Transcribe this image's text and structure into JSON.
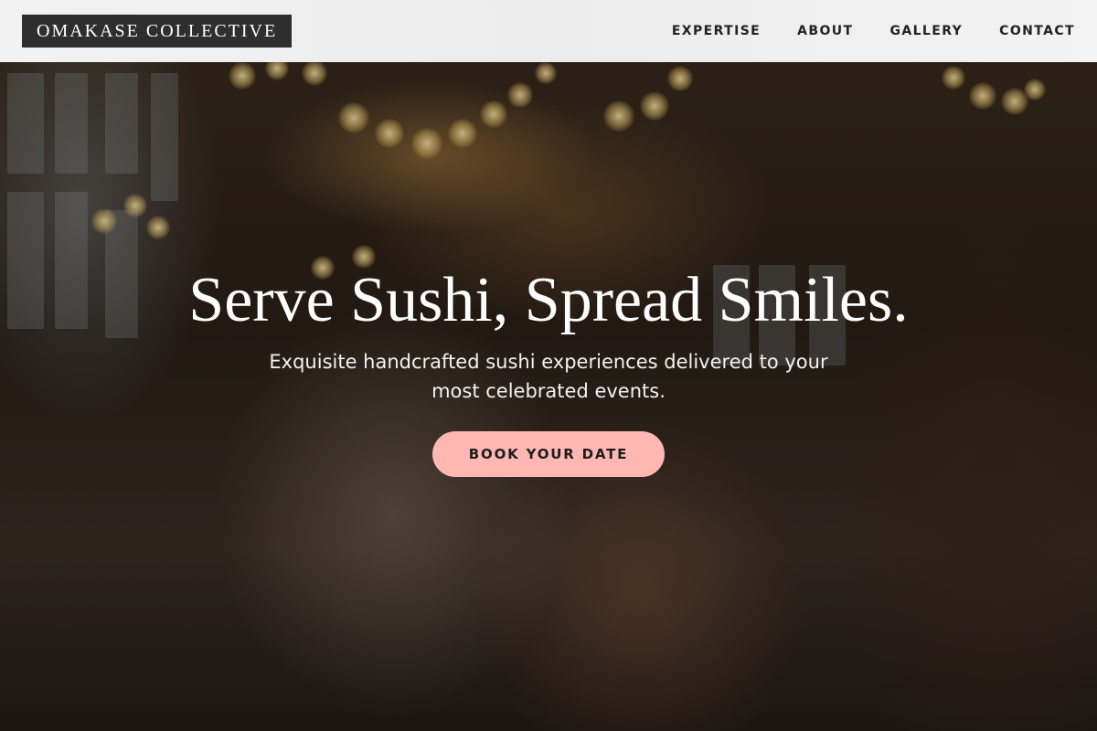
{
  "brand": {
    "name": "OMAKASE COLLECTIVE"
  },
  "nav": {
    "items": [
      {
        "label": "EXPERTISE"
      },
      {
        "label": "ABOUT"
      },
      {
        "label": "GALLERY"
      },
      {
        "label": "CONTACT"
      }
    ]
  },
  "hero": {
    "title": "Serve Sushi, Spread Smiles.",
    "subtitle": "Exquisite handcrafted sushi experiences delivered to your most celebrated events.",
    "cta_label": "BOOK YOUR DATE",
    "background_description_icon": "celebration-photo"
  },
  "colors": {
    "header_bg": "#f0f0f0",
    "logo_bg": "#2e2e2e",
    "cta_bg": "#ffb7b3",
    "nav_text": "#222222"
  }
}
